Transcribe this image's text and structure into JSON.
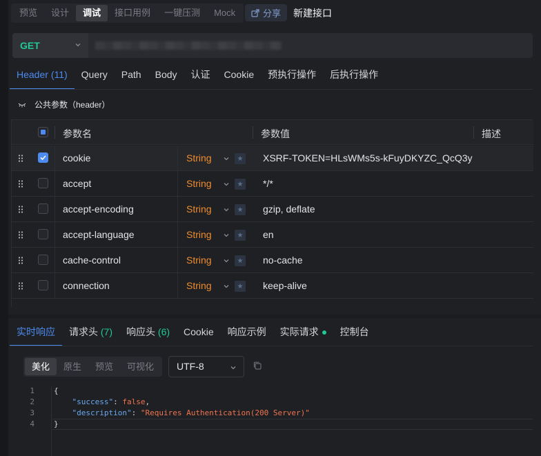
{
  "mode_tabs": [
    "预览",
    "设计",
    "调试",
    "接口用例",
    "一键压测",
    "Mock"
  ],
  "active_mode": "调试",
  "share_label": "分享",
  "api_name": "新建接口",
  "request": {
    "method": "GET",
    "method_color": "#21c993"
  },
  "request_tabs": [
    {
      "label": "Header",
      "count": "(11)"
    },
    {
      "label": "Query",
      "count": ""
    },
    {
      "label": "Path",
      "count": ""
    },
    {
      "label": "Body",
      "count": ""
    },
    {
      "label": "认证",
      "count": ""
    },
    {
      "label": "Cookie",
      "count": ""
    },
    {
      "label": "预执行操作",
      "count": ""
    },
    {
      "label": "后执行操作",
      "count": ""
    }
  ],
  "public_params_label": "公共参数（header）",
  "table": {
    "headers": {
      "name": "参数名",
      "value": "参数值",
      "desc": "描述"
    },
    "rows": [
      {
        "name": "cookie",
        "type": "String",
        "value": "XSRF-TOKEN=HLsWMs5s-kFuyDKYZC_QcQ3y",
        "checked": true
      },
      {
        "name": "accept",
        "type": "String",
        "value": "*/*",
        "checked": false
      },
      {
        "name": "accept-encoding",
        "type": "String",
        "value": "gzip, deflate",
        "checked": false
      },
      {
        "name": "accept-language",
        "type": "String",
        "value": "en",
        "checked": false
      },
      {
        "name": "cache-control",
        "type": "String",
        "value": "no-cache",
        "checked": false
      },
      {
        "name": "connection",
        "type": "String",
        "value": "keep-alive",
        "checked": false
      }
    ]
  },
  "response_tabs": {
    "live": "实时响应",
    "req_headers": "请求头",
    "req_headers_count": "(7)",
    "resp_headers": "响应头",
    "resp_headers_count": "(6)",
    "cookie": "Cookie",
    "example": "响应示例",
    "actual": "实际请求",
    "console": "控制台"
  },
  "view_modes": [
    "美化",
    "原生",
    "预览",
    "可视化"
  ],
  "active_view": "美化",
  "encoding": "UTF-8",
  "response_code": {
    "line_numbers": [
      "1",
      "2",
      "3",
      "4"
    ],
    "open_brace": "{",
    "close_brace": "}",
    "success_key": "\"success\"",
    "success_value": "false",
    "description_key": "\"description\"",
    "description_value": "\"Requires Authentication(200 Server)\""
  },
  "colors": {
    "accent": "#4d8bf0",
    "type": "#f08c2e",
    "green": "#21c993"
  }
}
